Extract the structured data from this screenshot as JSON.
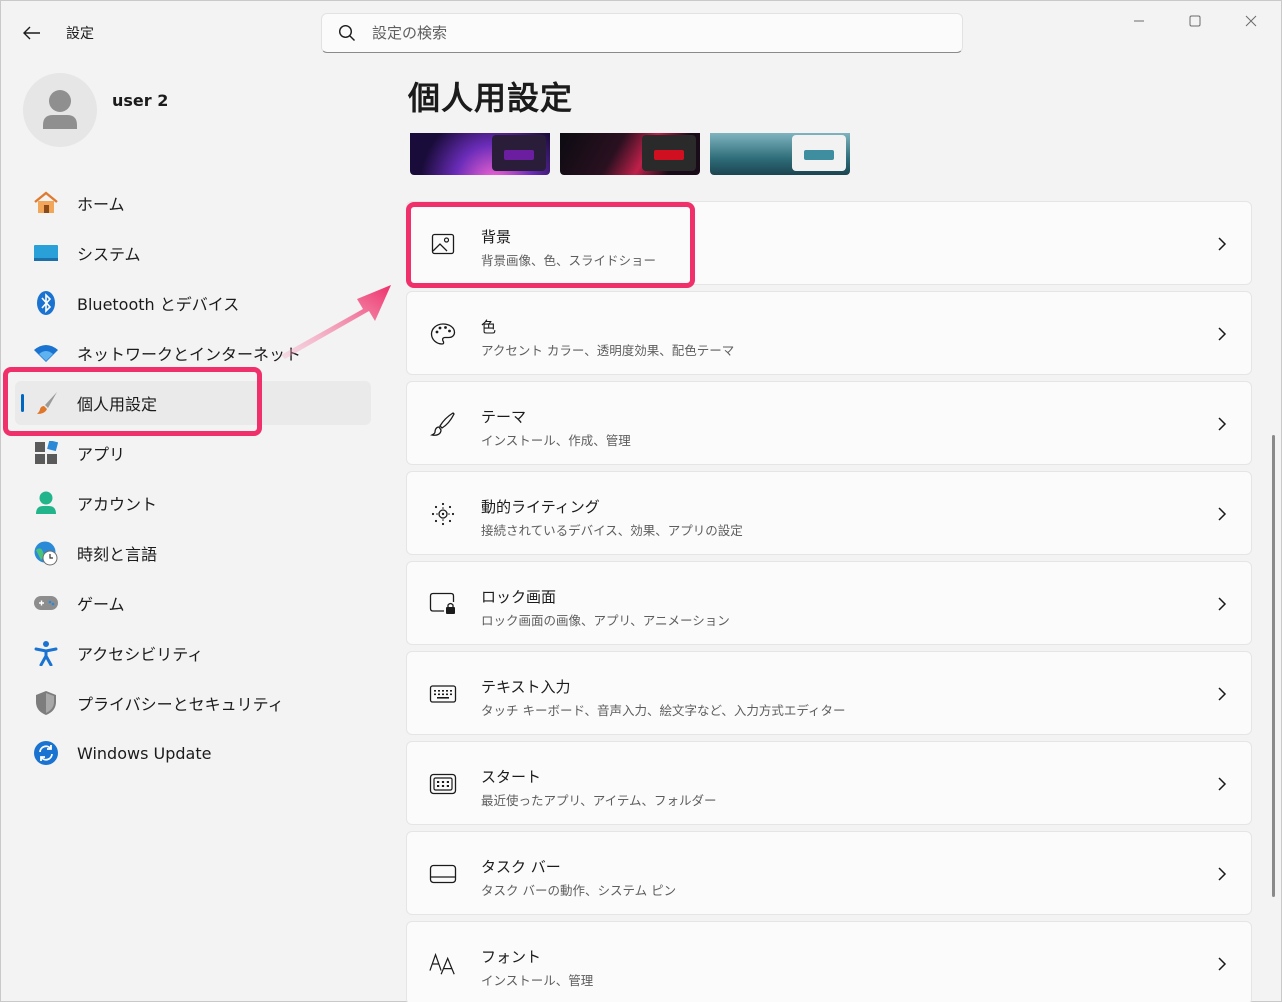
{
  "window": {
    "title": "設定",
    "search_placeholder": "設定の検索"
  },
  "user": {
    "name": "user 2"
  },
  "sidebar": {
    "items": [
      {
        "label": "ホーム"
      },
      {
        "label": "システム"
      },
      {
        "label": "Bluetooth とデバイス"
      },
      {
        "label": "ネットワークとインターネット"
      },
      {
        "label": "個人用設定",
        "active": true
      },
      {
        "label": "アプリ"
      },
      {
        "label": "アカウント"
      },
      {
        "label": "時刻と言語"
      },
      {
        "label": "ゲーム"
      },
      {
        "label": "アクセシビリティ"
      },
      {
        "label": "プライバシーとセキュリティ"
      },
      {
        "label": "Windows Update"
      }
    ]
  },
  "main": {
    "title": "個人用設定",
    "cards": [
      {
        "title": "背景",
        "subtitle": "背景画像、色、スライドショー",
        "icon": "image-icon"
      },
      {
        "title": "色",
        "subtitle": "アクセント カラー、透明度効果、配色テーマ",
        "icon": "palette-icon"
      },
      {
        "title": "テーマ",
        "subtitle": "インストール、作成、管理",
        "icon": "brush-icon"
      },
      {
        "title": "動的ライティング",
        "subtitle": "接続されているデバイス、効果、アプリの設定",
        "icon": "lighting-icon"
      },
      {
        "title": "ロック画面",
        "subtitle": "ロック画面の画像、アプリ、アニメーション",
        "icon": "lock-screen-icon"
      },
      {
        "title": "テキスト入力",
        "subtitle": "タッチ キーボード、音声入力、絵文字など、入力方式エディター",
        "icon": "keyboard-icon"
      },
      {
        "title": "スタート",
        "subtitle": "最近使ったアプリ、アイテム、フォルダー",
        "icon": "start-icon"
      },
      {
        "title": "タスク バー",
        "subtitle": "タスク バーの動作、システム ピン",
        "icon": "taskbar-icon"
      },
      {
        "title": "フォント",
        "subtitle": "インストール、管理",
        "icon": "font-icon"
      }
    ]
  },
  "colors": {
    "accent": "#0067c0",
    "highlight": "#f0306b"
  }
}
